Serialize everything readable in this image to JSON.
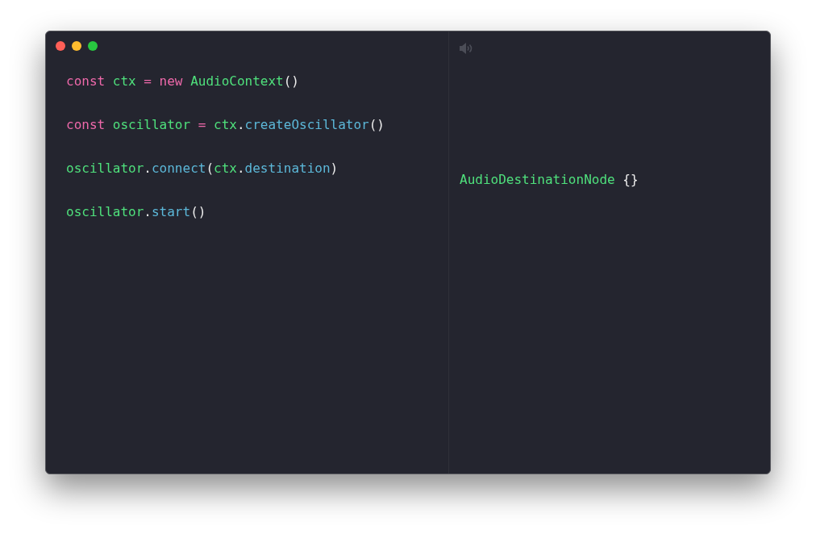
{
  "window": {
    "controls": [
      {
        "kind": "close"
      },
      {
        "kind": "minimize"
      },
      {
        "kind": "zoom"
      }
    ]
  },
  "editor": {
    "lines": [
      {
        "tokens": [
          {
            "text": "const ",
            "kind": "keyword"
          },
          {
            "text": "ctx ",
            "kind": "name"
          },
          {
            "text": "= ",
            "kind": "operator"
          },
          {
            "text": "new ",
            "kind": "keyword"
          },
          {
            "text": "AudioContext",
            "kind": "name"
          },
          {
            "text": "()",
            "kind": "punct"
          }
        ]
      },
      {
        "tokens": [
          {
            "text": "const ",
            "kind": "keyword"
          },
          {
            "text": "oscillator ",
            "kind": "name"
          },
          {
            "text": "= ",
            "kind": "operator"
          },
          {
            "text": "ctx",
            "kind": "name"
          },
          {
            "text": ".",
            "kind": "punct"
          },
          {
            "text": "createOscillator",
            "kind": "member"
          },
          {
            "text": "()",
            "kind": "punct"
          }
        ]
      },
      {
        "tokens": [
          {
            "text": "oscillator",
            "kind": "name"
          },
          {
            "text": ".",
            "kind": "punct"
          },
          {
            "text": "connect",
            "kind": "member"
          },
          {
            "text": "(",
            "kind": "punct"
          },
          {
            "text": "ctx",
            "kind": "name"
          },
          {
            "text": ".",
            "kind": "punct"
          },
          {
            "text": "destination",
            "kind": "member"
          },
          {
            "text": ")",
            "kind": "punct"
          }
        ],
        "output": [
          {
            "text": "AudioDestinationNode ",
            "kind": "name"
          },
          {
            "text": "{}",
            "kind": "punct"
          }
        ]
      },
      {
        "tokens": [
          {
            "text": "oscillator",
            "kind": "name"
          },
          {
            "text": ".",
            "kind": "punct"
          },
          {
            "text": "start",
            "kind": "member"
          },
          {
            "text": "()",
            "kind": "punct"
          }
        ]
      }
    ]
  }
}
